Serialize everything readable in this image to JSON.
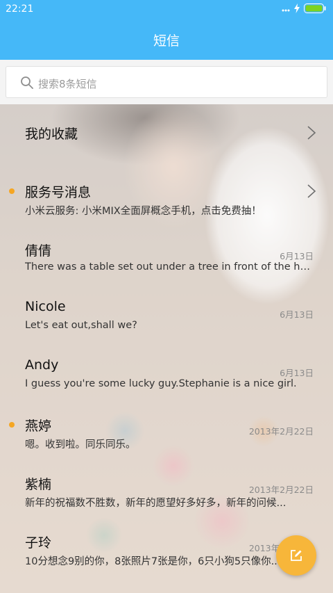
{
  "status_bar": {
    "time": "22:21"
  },
  "header": {
    "title": "短信"
  },
  "search": {
    "placeholder": "搜索8条短信"
  },
  "conversations": [
    {
      "name": "我的收藏",
      "preview": "",
      "date": "",
      "unread": false,
      "chevron": true
    },
    {
      "name": "服务号消息",
      "preview": "小米云服务: 小米MIX全面屏概念手机，点击免费抽！",
      "date": "",
      "unread": true,
      "chevron": true
    },
    {
      "name": "倩倩",
      "preview": "There was a table set out under a tree in front of the ho...",
      "date": "6月13日",
      "unread": false,
      "chevron": false
    },
    {
      "name": "Nicole",
      "preview": "Let's eat out,shall we?",
      "date": "6月13日",
      "unread": false,
      "chevron": false
    },
    {
      "name": "Andy",
      "preview": "I guess you're some lucky guy.Stephanie is a nice girl.",
      "date": "6月13日",
      "unread": false,
      "chevron": false
    },
    {
      "name": "燕婷",
      "preview": "嗯。收到啦。同乐同乐。",
      "date": "2013年2月22日",
      "unread": true,
      "chevron": false
    },
    {
      "name": "紫楠",
      "preview": "新年的祝福数不胜数，新年的愿望好多好多，新年的问候...",
      "date": "2013年2月22日",
      "unread": false,
      "chevron": false
    },
    {
      "name": "子玲",
      "preview": "10分想念9别的你，8张照片7张是你，6只小狗5只像你...",
      "date": "2013年2月22日",
      "unread": false,
      "chevron": false
    }
  ],
  "colors": {
    "header": "#45b8f8",
    "unread_dot": "#f5a623",
    "fab": "#f7b63a"
  },
  "icons": {
    "search": "search-icon",
    "compose": "compose-icon",
    "chevron": "chevron-right-icon"
  }
}
